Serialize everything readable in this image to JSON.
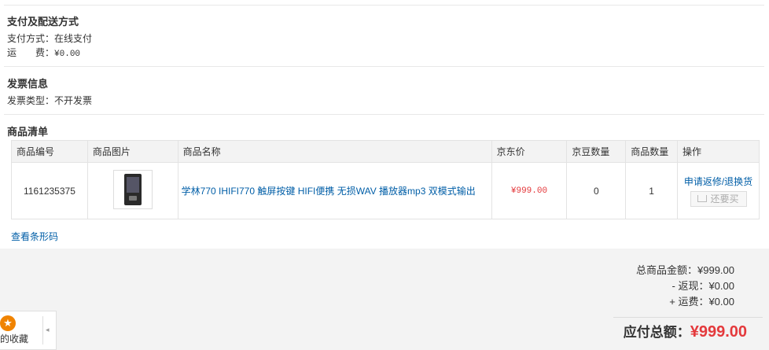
{
  "payment": {
    "title": "支付及配送方式",
    "method_label": "支付方式：",
    "method_value": "在线支付",
    "freight_label": "运　　费：",
    "freight_value": "¥0.00"
  },
  "invoice": {
    "title": "发票信息",
    "type_label": "发票类型：",
    "type_value": "不开发票"
  },
  "goods": {
    "title": "商品清单",
    "headers": [
      "商品编号",
      "商品图片",
      "商品名称",
      "京东价",
      "京豆数量",
      "商品数量",
      "操作"
    ],
    "rows": [
      {
        "id": "1161235375",
        "name": "学林770 IHIFI770 触屏按键 HIFI便携 无损WAV 播放器mp3 双模式输出",
        "price": "¥999.00",
        "beans": "0",
        "quantity": "1",
        "action_link": "申请返修/退换货",
        "rebuy_label": "还要买"
      }
    ],
    "barcode_link": "查看条形码"
  },
  "summary": {
    "goods_total": "总商品金额：¥999.00",
    "rebate": "- 返现：¥0.00",
    "freight": "+ 运费：¥0.00",
    "payable_label": "应付总额：",
    "payable_amount": "¥999.00"
  },
  "favorites": {
    "label": "的收藏",
    "star": "★",
    "arrow": "◂"
  },
  "colors": {
    "link": "#005ea7",
    "price": "#e4393c",
    "header_bg": "#f3f3f3"
  }
}
